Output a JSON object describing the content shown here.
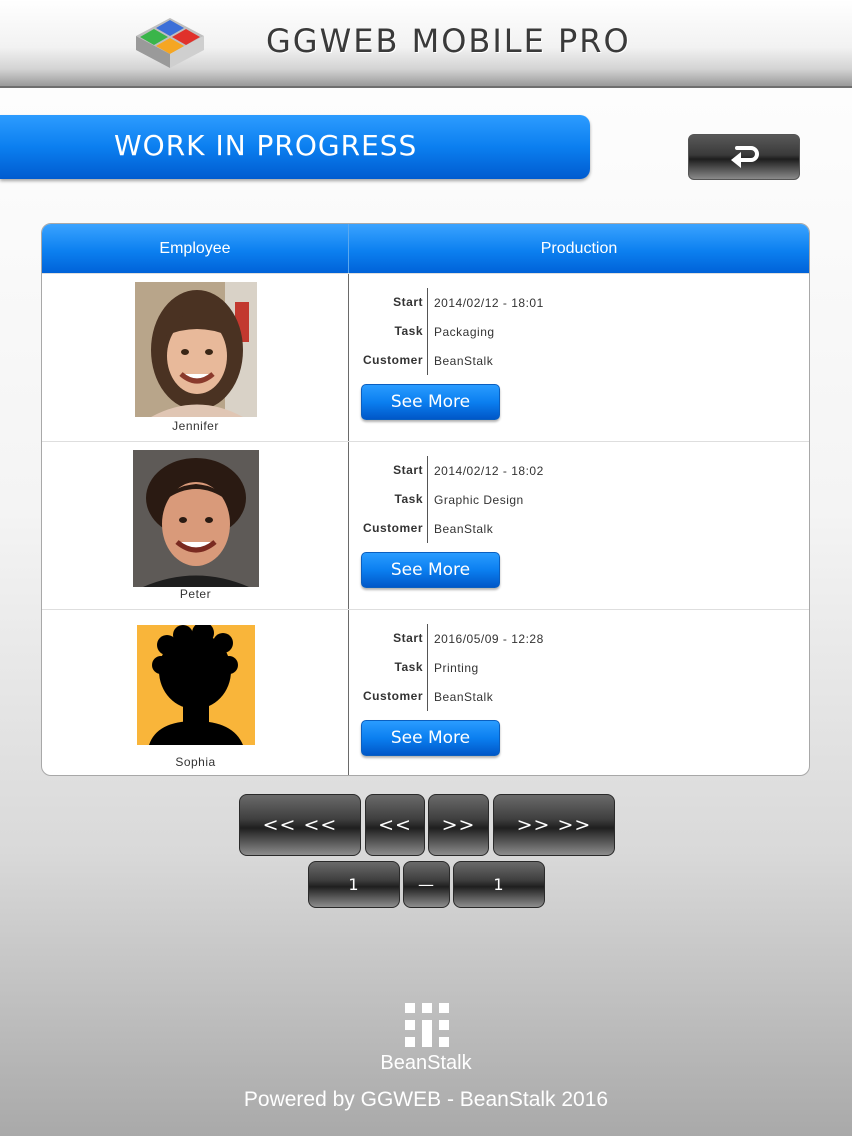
{
  "header": {
    "title": "GGWEB MOBILE PRO",
    "logo_icon": "ggweb-logo-icon"
  },
  "banner": {
    "title": "WORK IN PROGRESS",
    "back_icon": "return-arrow-icon"
  },
  "table": {
    "columns": [
      "Employee",
      "Production"
    ],
    "info_labels": {
      "start": "Start",
      "task": "Task",
      "customer": "Customer"
    },
    "see_more_label": "See More",
    "rows": [
      {
        "employee": "Jennifer",
        "start": "2014/02/12 - 18:01",
        "task": "Packaging",
        "customer": "BeanStalk"
      },
      {
        "employee": "Peter",
        "start": "2014/02/12 - 18:02",
        "task": "Graphic Design",
        "customer": "BeanStalk"
      },
      {
        "employee": "Sophia",
        "start": "2016/05/09 - 12:28",
        "task": "Printing",
        "customer": "BeanStalk"
      }
    ]
  },
  "pagination": {
    "first": "<< <<",
    "prev": "<<",
    "next": ">>",
    "last": ">> >>",
    "current_page": "1",
    "separator": "—",
    "total_pages": "1"
  },
  "footer": {
    "brand": "BeanStalk",
    "brand_icon": "beanstalk-logo-icon",
    "powered_by": "Powered by GGWEB - BeanStalk 2016"
  },
  "colors": {
    "accent_blue": "#0b7ff0",
    "dark_button": "#3a3a3a"
  }
}
